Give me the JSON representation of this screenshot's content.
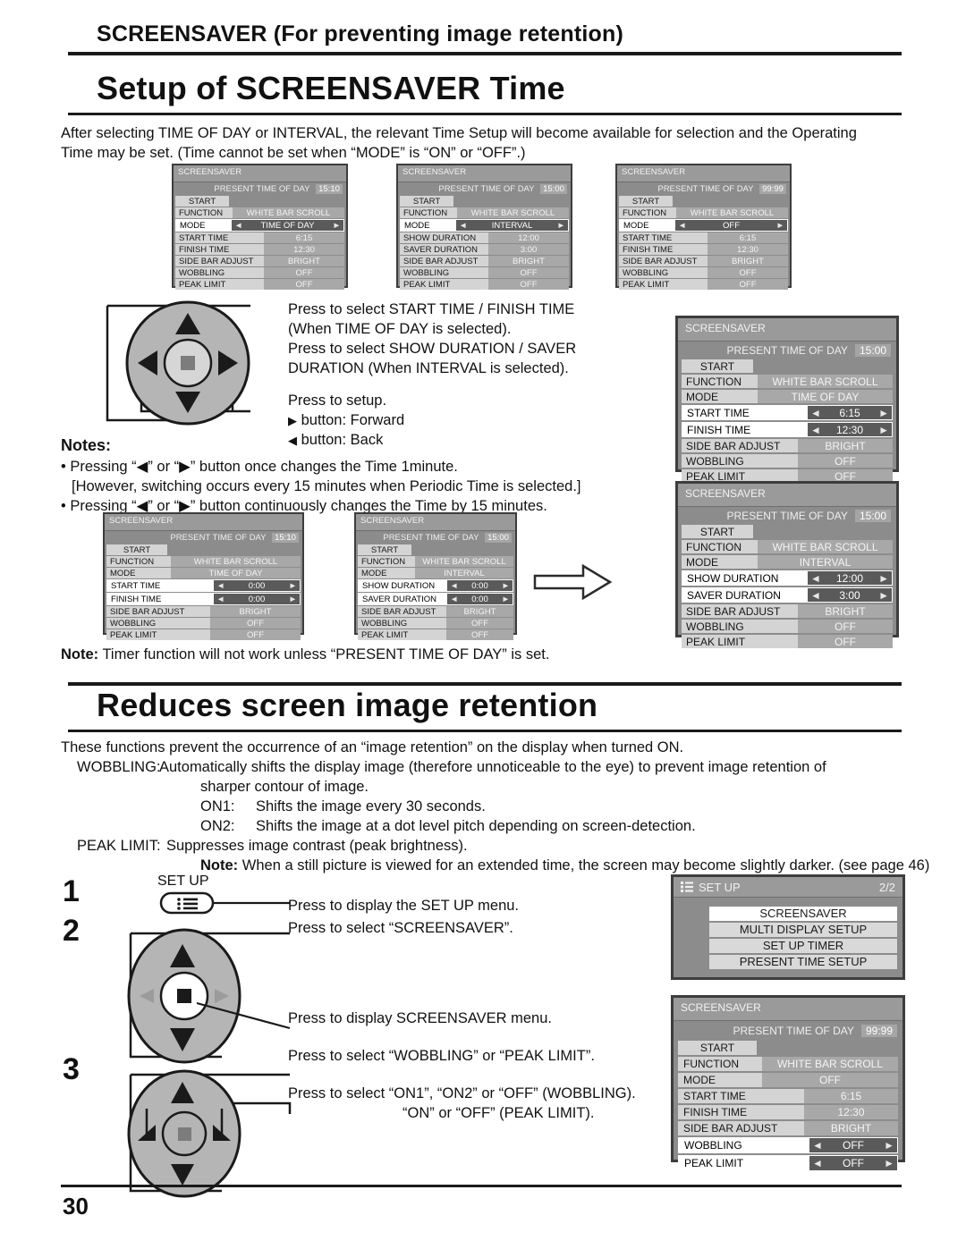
{
  "header": {
    "kicker": "SCREENSAVER (For preventing image retention)",
    "title1": "Setup of SCREENSAVER Time",
    "title2": "Reduces screen image retention"
  },
  "intro": {
    "line1": "After selecting TIME OF DAY or INTERVAL, the relevant Time Setup will become available for selection and the Operating",
    "line2": "Time may be set. (Time cannot be set when “MODE” is “ON” or “OFF”.)"
  },
  "osd_common": {
    "title": "SCREENSAVER",
    "present_label": "PRESENT  TIME OF DAY",
    "start": "START",
    "function_label": "FUNCTION",
    "function_value": "WHITE BAR SCROLL",
    "mode_label": "MODE",
    "start_time_label": "START TIME",
    "finish_time_label": "FINISH TIME",
    "show_duration_label": "SHOW DURATION",
    "saver_duration_label": "SAVER DURATION",
    "side_bar_label": "SIDE BAR ADJUST",
    "side_bar_value": "BRIGHT",
    "wobbling_label": "WOBBLING",
    "wobbling_value": "OFF",
    "peak_limit_label": "PEAK LIMIT",
    "peak_limit_value": "OFF",
    "arrow_left": "◄",
    "arrow_right": "►"
  },
  "panel_top1": {
    "present_value": "15:10",
    "mode_value": "TIME OF DAY",
    "row1_value": "6:15",
    "row2_value": "12:30"
  },
  "panel_top2": {
    "present_value": "15:00",
    "mode_value": "INTERVAL",
    "row1_value": "12:00",
    "row2_value": "3:00"
  },
  "panel_top3": {
    "present_value": "99:99",
    "mode_value": "OFF",
    "row1_value": "6:15",
    "row2_value": "12:30"
  },
  "panel_big1": {
    "present_value": "15:00",
    "mode_value": "TIME OF DAY",
    "row1_value": "6:15",
    "row2_value": "12:30"
  },
  "panel_big2": {
    "present_value": "15:00",
    "mode_value": "INTERVAL",
    "row1_value": "12:00",
    "row2_value": "3:00"
  },
  "panel_low1": {
    "present_value": "15:10",
    "mode_value": "TIME OF DAY",
    "row1_value": "0:00",
    "row2_value": "0:00"
  },
  "panel_low2": {
    "present_value": "15:00",
    "mode_value": "INTERVAL",
    "row1_value": "0:00",
    "row2_value": "0:00"
  },
  "panel_bottom": {
    "present_value": "99:99",
    "mode_value": "OFF",
    "row1_value": "6:15",
    "row2_value": "12:30",
    "wobbling_value": "OFF",
    "peak_limit_value": "OFF"
  },
  "instructions": {
    "l1": "Press to select START TIME / FINISH TIME",
    "l2": "(When TIME OF DAY is selected).",
    "l3": "Press  to  select  SHOW  DURATION  /  SAVER",
    "l4": "DURATION (When INTERVAL is selected).",
    "l5": "Press to setup.",
    "l6_arrow": "▶",
    "l6": "button: Forward",
    "l7_arrow": "◀",
    "l7": "button: Back"
  },
  "notes": {
    "heading": "Notes:",
    "n1": "• Pressing “◀” or “▶” button once changes the Time 1minute.",
    "n2": "[However, switching occurs every 15 minutes when Periodic Time is selected.]",
    "n3": "• Pressing “◀” or “▶” button continuously changes the Time by 15 minutes.",
    "note_bold": "Note:",
    "note_text": "Timer function will not work unless “PRESENT TIME OF DAY” is set."
  },
  "retention": {
    "p1": "These functions prevent the occurrence of an “image retention” on the display when turned ON.",
    "wobbling_key": "WOBBLING:",
    "wobbling_1": "Automatically shifts the display image (therefore unnoticeable to the eye) to prevent image retention of",
    "wobbling_2": "sharper contour of image.",
    "on1_key": "ON1:",
    "on1_text": "Shifts the image every 30 seconds.",
    "on2_key": "ON2:",
    "on2_text": "Shifts the image at a dot level pitch depending on screen-detection.",
    "peak_key": "PEAK LIMIT:",
    "peak_text": "Suppresses image contrast (peak brightness).",
    "note_bold": "Note:",
    "note_text": "When a still picture is viewed for an extended time, the screen may become slightly darker. (see page 46)"
  },
  "steps": {
    "num1": "1",
    "num2": "2",
    "num3": "3",
    "setup_button_label": "SET UP",
    "s1": "Press to display the SET UP menu.",
    "s2": "Press to select “SCREENSAVER”.",
    "s3": "Press to display SCREENSAVER menu.",
    "s4": "Press to select “WOBBLING” or “PEAK LIMIT”.",
    "s5": "Press to select “ON1”, “ON2” or “OFF” (WOBBLING).",
    "s6": "“ON” or “OFF” (PEAK LIMIT)."
  },
  "setup_menu": {
    "title": "SET UP",
    "page": "2/2",
    "items": [
      "SCREENSAVER",
      "MULTI DISPLAY SETUP",
      "SET UP TIMER",
      "PRESENT TIME SETUP"
    ]
  },
  "footer": {
    "page_number": "30"
  }
}
